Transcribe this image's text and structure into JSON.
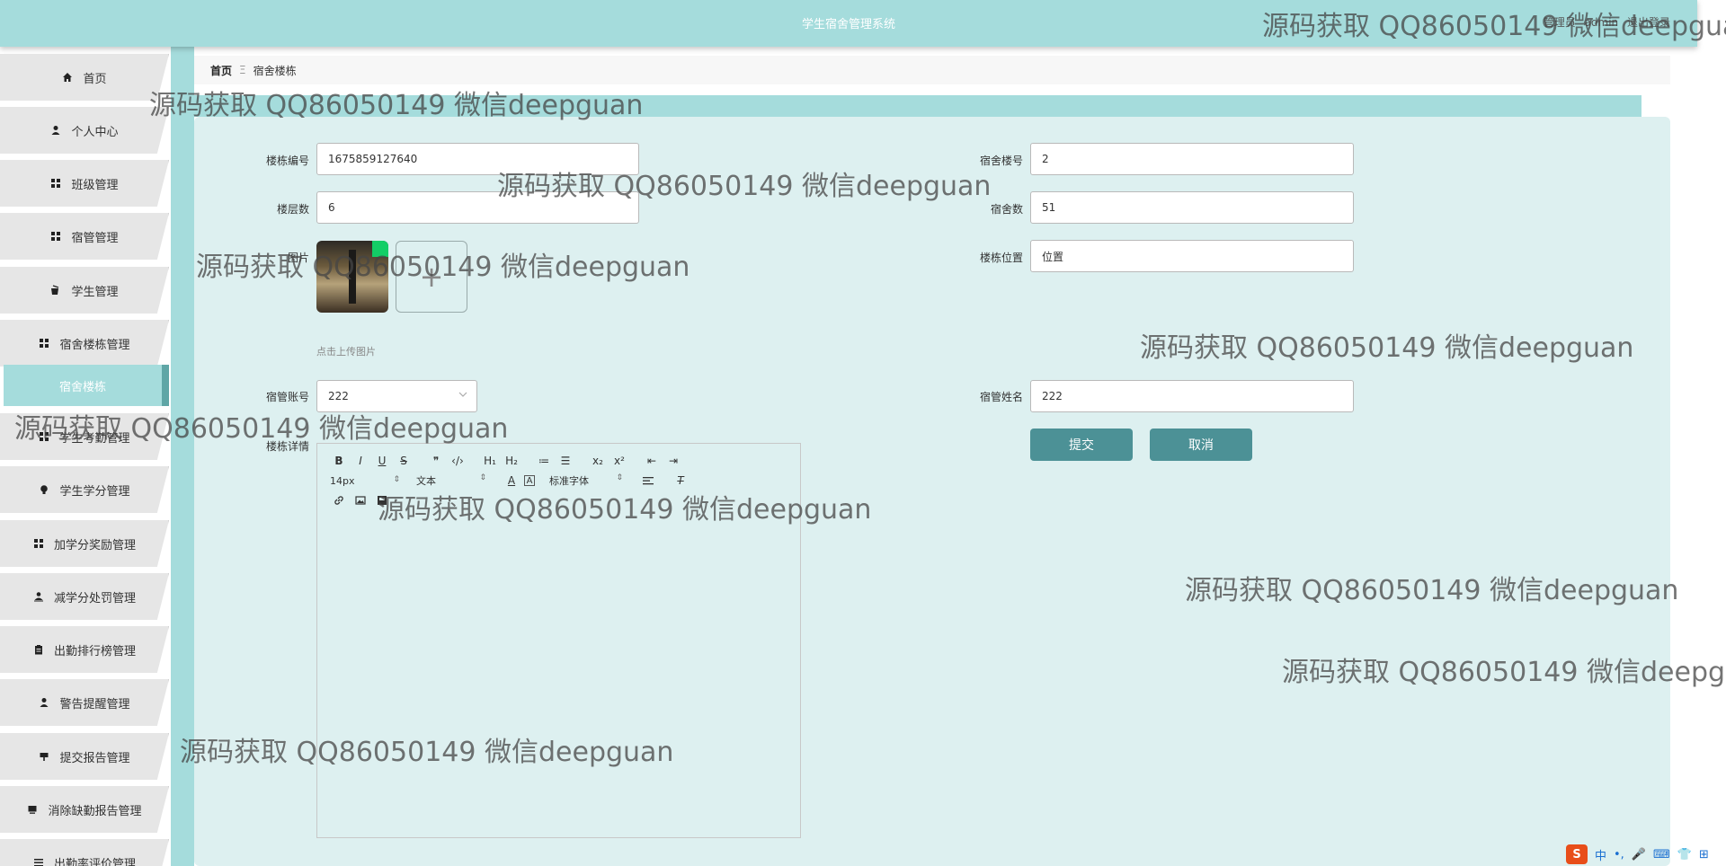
{
  "header": {
    "title": "学生宿舍管理系统",
    "user_role": "管理员",
    "user_name": "admin",
    "logout": "退出登录"
  },
  "sidebar": {
    "items": [
      {
        "label": "首页",
        "icon": "home-icon"
      },
      {
        "label": "个人中心",
        "icon": "user-icon"
      },
      {
        "label": "班级管理",
        "icon": "grid-icon"
      },
      {
        "label": "宿管管理",
        "icon": "grid-icon"
      },
      {
        "label": "学生管理",
        "icon": "cup-icon"
      },
      {
        "label": "宿舍楼栋管理",
        "icon": "grid-icon"
      },
      {
        "label": "宿舍楼栋",
        "icon": "",
        "active": true
      },
      {
        "label": "学生考勤管理",
        "icon": "grid-icon"
      },
      {
        "label": "学生学分管理",
        "icon": "bulb-icon"
      },
      {
        "label": "加学分奖励管理",
        "icon": "grid-icon"
      },
      {
        "label": "减学分处罚管理",
        "icon": "user-down-icon"
      },
      {
        "label": "出勤排行榜管理",
        "icon": "clipboard-icon"
      },
      {
        "label": "警告提醒管理",
        "icon": "user-icon"
      },
      {
        "label": "提交报告管理",
        "icon": "sign-icon"
      },
      {
        "label": "消除缺勤报告管理",
        "icon": "monitor-icon"
      },
      {
        "label": "出勤率评价管理",
        "icon": "list-icon"
      }
    ]
  },
  "breadcrumb": {
    "home": "首页",
    "separator": "Ξ",
    "current": "宿舍楼栋"
  },
  "form": {
    "building_no_label": "楼栋编号",
    "building_no_value": "1675859127640",
    "dorm_building_label": "宿舍楼号",
    "dorm_building_value": "2",
    "floors_label": "楼层数",
    "floors_value": "6",
    "dorm_count_label": "宿舍数",
    "dorm_count_value": "51",
    "image_label": "图片",
    "location_label": "楼栋位置",
    "location_value": "位置",
    "upload_hint": "点击上传图片",
    "plus": "+",
    "manager_account_label": "宿管账号",
    "manager_account_value": "222",
    "manager_name_label": "宿管姓名",
    "manager_name_value": "222",
    "details_label": "楼栋详情",
    "submit": "提交",
    "cancel": "取消"
  },
  "editor": {
    "font_size": "14px",
    "paragraph": "文本",
    "font_family": "标准字体",
    "tools_row1": [
      "B",
      "I",
      "U",
      "S",
      "❞",
      "‹/›",
      "H₁",
      "H₂",
      "≔",
      "☰",
      "x₂",
      "x²",
      "⇤",
      "⇥"
    ],
    "tools_row3": [
      "🔗",
      "▣",
      "▦"
    ]
  },
  "watermark": "源码获取 QQ86050149 微信deepguan",
  "ime": {
    "logo": "S",
    "lang": "中",
    "items": [
      "•,",
      "🎤",
      "⌨",
      "👕",
      "⊞"
    ]
  },
  "colors": {
    "header_bg": "#a5dcdc",
    "panel_bg": "#ddf0f0",
    "button_bg": "#4c9196",
    "menu_bg": "#e6e6e6"
  }
}
